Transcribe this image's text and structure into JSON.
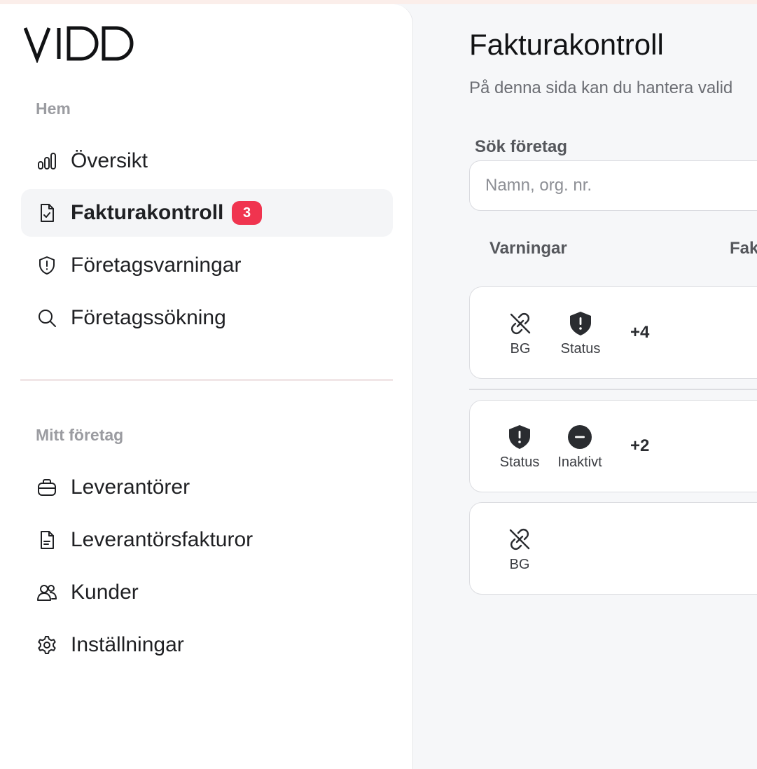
{
  "app": {
    "logo_text": "VIDD"
  },
  "sidebar": {
    "section_home": "Hem",
    "nav_main": [
      {
        "label": "Översikt",
        "icon": "bar-chart-icon"
      },
      {
        "label": "Fakturakontroll",
        "icon": "file-check-icon",
        "badge": "3",
        "active": true
      },
      {
        "label": "Företagsvarningar",
        "icon": "shield-alert-icon"
      },
      {
        "label": "Företagssökning",
        "icon": "search-icon"
      }
    ],
    "section_company": "Mitt företag",
    "nav_company": [
      {
        "label": "Leverantörer",
        "icon": "briefcase-icon"
      },
      {
        "label": "Leverantörsfakturor",
        "icon": "file-text-icon"
      },
      {
        "label": "Kunder",
        "icon": "users-icon"
      },
      {
        "label": "Inställningar",
        "icon": "gear-icon"
      }
    ]
  },
  "main": {
    "title": "Fakturakontroll",
    "description": "På denna sida kan du hantera valid",
    "search": {
      "label": "Sök företag",
      "placeholder": "Namn, org. nr.",
      "value": ""
    },
    "columns": [
      "Varningar",
      "Fak"
    ],
    "rows": [
      {
        "warnings": [
          {
            "label": "BG",
            "icon": "broken-link-icon"
          },
          {
            "label": "Status",
            "icon": "shield-alert-icon"
          }
        ],
        "more": "+4"
      },
      {
        "warnings": [
          {
            "label": "Status",
            "icon": "shield-alert-icon"
          },
          {
            "label": "Inaktivt",
            "icon": "minus-circle-icon"
          }
        ],
        "more": "+2"
      },
      {
        "warnings": [
          {
            "label": "BG",
            "icon": "broken-link-icon"
          }
        ],
        "more": ""
      }
    ]
  },
  "colors": {
    "badge": "#f0344f",
    "active_bg": "#f4f5f7",
    "page_bg": "#f6f7f9",
    "divider": "#f1e6e7"
  }
}
